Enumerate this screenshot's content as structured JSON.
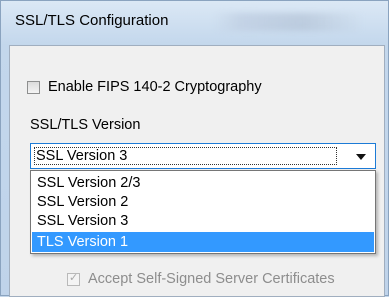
{
  "window": {
    "title": "SSL/TLS Configuration"
  },
  "fips": {
    "label": "Enable FIPS 140-2 Cryptography",
    "checked": false
  },
  "ssl_version": {
    "label": "SSL/TLS Version",
    "selected": "SSL Version 3",
    "options": [
      "SSL Version 2/3",
      "SSL Version 2",
      "SSL Version 3",
      "TLS Version 1"
    ],
    "highlighted": "TLS Version 1"
  },
  "accept_self_signed": {
    "label": "Accept Self-Signed Server Certificates",
    "checked": true,
    "enabled": false
  },
  "colors": {
    "highlight": "#3399ff",
    "focus_border": "#1c7bd6",
    "disabled_text": "#8d8d8d"
  }
}
